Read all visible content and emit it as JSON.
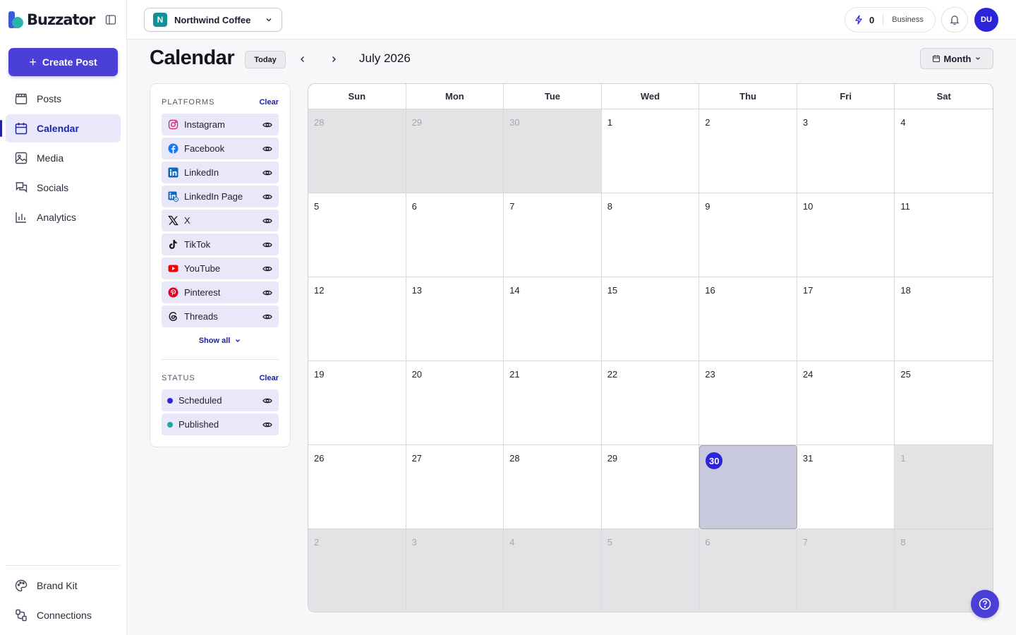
{
  "brand": {
    "name": "Buzzator"
  },
  "sidebar": {
    "create_label": "Create Post",
    "items": [
      {
        "label": "Posts",
        "icon": "clapperboard-icon"
      },
      {
        "label": "Calendar",
        "icon": "calendar-icon",
        "active": true
      },
      {
        "label": "Media",
        "icon": "image-icon"
      },
      {
        "label": "Socials",
        "icon": "chat-icon"
      },
      {
        "label": "Analytics",
        "icon": "bar-chart-icon"
      }
    ],
    "bottom_items": [
      {
        "label": "Brand Kit",
        "icon": "palette-icon"
      },
      {
        "label": "Connections",
        "icon": "plug-icon"
      }
    ]
  },
  "topbar": {
    "workspace_initial": "N",
    "workspace_name": "Northwind Coffee",
    "credits": "0",
    "plan": "Business",
    "avatar_initials": "DU"
  },
  "header": {
    "title": "Calendar",
    "today_label": "Today",
    "month_label": "July 2026",
    "view_label": "Month"
  },
  "filters": {
    "platforms_title": "PLATFORMS",
    "clear_label": "Clear",
    "platforms": [
      {
        "label": "Instagram",
        "icon": "instagram-icon"
      },
      {
        "label": "Facebook",
        "icon": "facebook-icon"
      },
      {
        "label": "LinkedIn",
        "icon": "linkedin-icon"
      },
      {
        "label": "LinkedIn Page",
        "icon": "linkedin-page-icon"
      },
      {
        "label": "X",
        "icon": "x-icon"
      },
      {
        "label": "TikTok",
        "icon": "tiktok-icon"
      },
      {
        "label": "YouTube",
        "icon": "youtube-icon"
      },
      {
        "label": "Pinterest",
        "icon": "pinterest-icon"
      },
      {
        "label": "Threads",
        "icon": "threads-icon"
      }
    ],
    "show_all_label": "Show all",
    "status_title": "STATUS",
    "statuses": [
      {
        "label": "Scheduled",
        "color": "#2c24d9"
      },
      {
        "label": "Published",
        "color": "#1aa8a0"
      }
    ]
  },
  "calendar": {
    "weekdays": [
      "Sun",
      "Mon",
      "Tue",
      "Wed",
      "Thu",
      "Fri",
      "Sat"
    ],
    "days": [
      {
        "n": "28",
        "out": true
      },
      {
        "n": "29",
        "out": true
      },
      {
        "n": "30",
        "out": true
      },
      {
        "n": "1"
      },
      {
        "n": "2"
      },
      {
        "n": "3"
      },
      {
        "n": "4"
      },
      {
        "n": "5"
      },
      {
        "n": "6"
      },
      {
        "n": "7"
      },
      {
        "n": "8"
      },
      {
        "n": "9"
      },
      {
        "n": "10"
      },
      {
        "n": "11"
      },
      {
        "n": "12"
      },
      {
        "n": "13"
      },
      {
        "n": "14"
      },
      {
        "n": "15"
      },
      {
        "n": "16"
      },
      {
        "n": "17"
      },
      {
        "n": "18"
      },
      {
        "n": "19"
      },
      {
        "n": "20"
      },
      {
        "n": "21"
      },
      {
        "n": "22"
      },
      {
        "n": "23"
      },
      {
        "n": "24"
      },
      {
        "n": "25"
      },
      {
        "n": "26"
      },
      {
        "n": "27"
      },
      {
        "n": "28"
      },
      {
        "n": "29"
      },
      {
        "n": "30",
        "today": true
      },
      {
        "n": "31"
      },
      {
        "n": "1",
        "out": true
      },
      {
        "n": "2",
        "out": true
      },
      {
        "n": "3",
        "out": true
      },
      {
        "n": "4",
        "out": true
      },
      {
        "n": "5",
        "out": true
      },
      {
        "n": "6",
        "out": true
      },
      {
        "n": "7",
        "out": true
      },
      {
        "n": "8",
        "out": true
      }
    ]
  }
}
